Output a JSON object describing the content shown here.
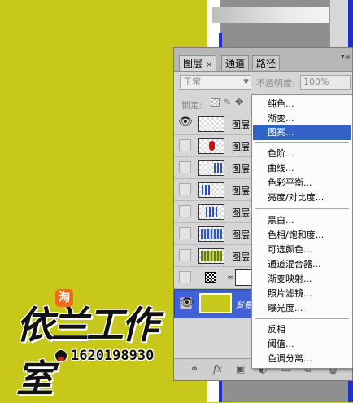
{
  "panel": {
    "tabs": [
      {
        "label": "图层",
        "close": "×"
      },
      {
        "label": "通道"
      },
      {
        "label": "路径"
      }
    ],
    "blend_mode": "正常",
    "opacity_label": "不透明度:",
    "opacity_value": "100%",
    "lock_label": "锁定:",
    "layers": [
      {
        "name": "图层",
        "visible": true,
        "thumb": "checker"
      },
      {
        "name": "图层",
        "visible": false,
        "thumb": "red-shape"
      },
      {
        "name": "图层",
        "visible": false,
        "thumb": "blue-dots"
      },
      {
        "name": "图层",
        "visible": false,
        "thumb": "blue-dots"
      },
      {
        "name": "图层",
        "visible": false,
        "thumb": "blue-dots"
      },
      {
        "name": "图层",
        "visible": false,
        "thumb": "blue-pattern"
      },
      {
        "name": "图层",
        "visible": false,
        "thumb": "green-grid"
      },
      {
        "name": "",
        "visible": false,
        "thumb": "adjustment"
      },
      {
        "name": "背景",
        "visible": true,
        "thumb": "yellow"
      }
    ],
    "footer_icons": [
      "link-icon",
      "fx-icon",
      "mask-icon",
      "adjustment-icon",
      "folder-icon",
      "new-layer-icon",
      "trash-icon"
    ],
    "footer_fx": "fx"
  },
  "menu": {
    "groups": [
      [
        "纯色...",
        "渐变...",
        "图案..."
      ],
      [
        "色阶...",
        "曲线...",
        "色彩平衡...",
        "亮度/对比度..."
      ],
      [
        "黑白...",
        "色相/饱和度...",
        "可选颜色...",
        "通道混合器...",
        "渐变映射...",
        "照片滤镜...",
        "曝光度..."
      ],
      [
        "反相",
        "阈值...",
        "色调分离..."
      ]
    ],
    "highlighted": "图案..."
  },
  "watermark": {
    "brand": "依兰工作室",
    "taobao": "淘",
    "qq": "1620198930"
  },
  "colors": {
    "background": "#c8c81a",
    "highlight": "#3163c5",
    "selected_layer": "#4161d6"
  }
}
